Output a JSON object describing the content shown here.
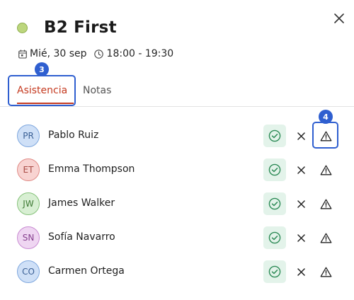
{
  "header": {
    "title": "B2 First",
    "dot_color": "#bcd67d",
    "date": "Mié, 30 sep",
    "time": "18:00 - 19:30",
    "close_icon": "close-icon",
    "calendar_icon": "calendar-icon",
    "clock_icon": "clock-icon"
  },
  "tabs": [
    {
      "label": "Asistencia",
      "active": true,
      "badge": "3"
    },
    {
      "label": "Notas",
      "active": false
    }
  ],
  "accent_color": "#c53a20",
  "highlight_color": "#2f5fd0",
  "attendance_badge": "4",
  "students": [
    {
      "initials": "PR",
      "name": "Pablo Ruiz",
      "bg": "#cfe0f7",
      "border": "#7ea7de",
      "fg": "#3a5f94"
    },
    {
      "initials": "ET",
      "name": "Emma Thompson",
      "bg": "#f8d3d1",
      "border": "#e08b86",
      "fg": "#a84a44"
    },
    {
      "initials": "JW",
      "name": "James Walker",
      "bg": "#d8efd3",
      "border": "#86c27a",
      "fg": "#3f7a35"
    },
    {
      "initials": "SN",
      "name": "Sofía Navarro",
      "bg": "#efd6f2",
      "border": "#c98bd2",
      "fg": "#87408f"
    },
    {
      "initials": "CO",
      "name": "Carmen Ortega",
      "bg": "#cfe0f7",
      "border": "#7ea7de",
      "fg": "#3a5f94"
    }
  ],
  "row_icons": {
    "present": "check-circle-icon",
    "absent": "x-icon",
    "late": "warning-triangle-icon"
  }
}
